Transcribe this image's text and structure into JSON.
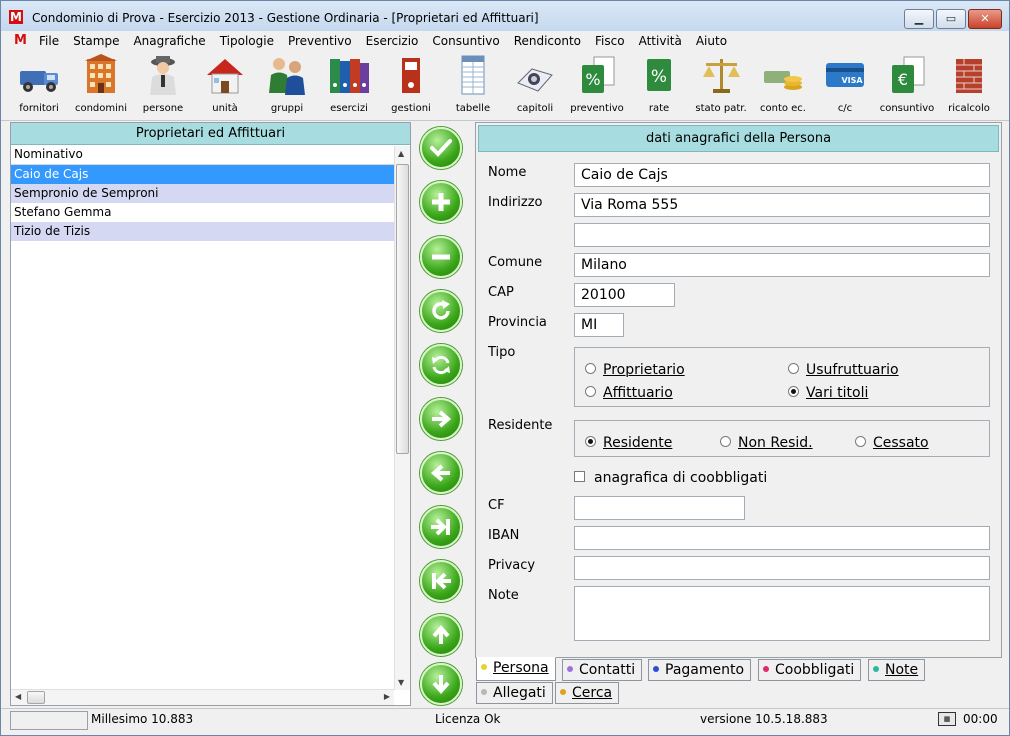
{
  "window": {
    "app_letter": "M",
    "title": "Condominio di Prova - Esercizio 2013 - Gestione Ordinaria - [Proprietari ed Affittuari]",
    "min_glyph": "▁",
    "max_glyph": "▭",
    "close_glyph": "✕"
  },
  "menu": {
    "icon_letter": "M",
    "items": [
      "File",
      "Stampe",
      "Anagrafiche",
      "Tipologie",
      "Preventivo",
      "Esercizio",
      "Consuntivo",
      "Rendiconto",
      "Fisco",
      "Attività",
      "Aiuto"
    ],
    "mdi_min": "_",
    "mdi_restore": "⧉",
    "mdi_close": "✕"
  },
  "toolbar": {
    "items": [
      {
        "label": "fornitori",
        "icon": "truck-icon"
      },
      {
        "label": "condomini",
        "icon": "building-icon"
      },
      {
        "label": "persone",
        "icon": "person-icon"
      },
      {
        "label": "unità",
        "icon": "house-icon"
      },
      {
        "label": "gruppi",
        "icon": "group-icon"
      },
      {
        "label": "esercizi",
        "icon": "binders-icon"
      },
      {
        "label": "gestioni",
        "icon": "binder-icon"
      },
      {
        "label": "tabelle",
        "icon": "table-icon"
      },
      {
        "label": "capitoli",
        "icon": "phonebook-icon"
      },
      {
        "label": "preventivo",
        "icon": "percent-doc-icon"
      },
      {
        "label": "rate",
        "icon": "percent-icon"
      },
      {
        "label": "stato patr.",
        "icon": "scale-icon"
      },
      {
        "label": "conto ec.",
        "icon": "coins-icon"
      },
      {
        "label": "c/c",
        "icon": "visa-card-icon"
      },
      {
        "label": "consuntivo",
        "icon": "euro-doc-icon"
      },
      {
        "label": "ricalcolo",
        "icon": "brickwall-icon"
      }
    ]
  },
  "list_panel": {
    "title": "Proprietari ed Affittuari",
    "column": "Nominativo",
    "rows": [
      "Caio de Cajs",
      "Sempronio de Semproni",
      "Stefano Gemma",
      "Tizio de Tizis"
    ],
    "selected_index": 0
  },
  "nav_buttons": [
    {
      "name": "confirm-button",
      "icon": "check-icon"
    },
    {
      "name": "add-button",
      "icon": "plus-icon"
    },
    {
      "name": "delete-button",
      "icon": "minus-icon"
    },
    {
      "name": "refresh-button",
      "icon": "refresh-icon"
    },
    {
      "name": "reload-button",
      "icon": "sync-icon"
    },
    {
      "name": "next-button",
      "icon": "arrow-right-icon"
    },
    {
      "name": "previous-button",
      "icon": "arrow-left-icon"
    },
    {
      "name": "last-button",
      "icon": "skip-end-icon"
    },
    {
      "name": "first-button",
      "icon": "skip-start-icon"
    },
    {
      "name": "move-up-button",
      "icon": "arrow-up-icon"
    },
    {
      "name": "move-down-button",
      "icon": "arrow-down-icon"
    }
  ],
  "form": {
    "title": "dati anagrafici della Persona",
    "labels": {
      "nome": "Nome",
      "indirizzo": "Indirizzo",
      "comune": "Comune",
      "cap": "CAP",
      "provincia": "Provincia",
      "tipo": "Tipo",
      "residente": "Residente",
      "cf": "CF",
      "iban": "IBAN",
      "privacy": "Privacy",
      "note": "Note"
    },
    "values": {
      "nome": "Caio de Cajs",
      "indirizzo": "Via Roma 555",
      "indirizzo2": "",
      "comune": "Milano",
      "cap": "20100",
      "provincia": "MI",
      "cf": "",
      "iban": "",
      "privacy": "",
      "note": ""
    },
    "tipo_options": [
      "Proprietario",
      "Usufruttuario",
      "Affittuario",
      "Vari titoli"
    ],
    "tipo_selected": "Vari titoli",
    "residente_options": [
      "Residente",
      "Non Resid.",
      "Cessato"
    ],
    "residente_selected": "Residente",
    "coobbligati_label": "anagrafica di coobbligati",
    "coobbligati_checked": false
  },
  "tabs": [
    {
      "label": "Persona",
      "color": "#e3d52a",
      "active": true
    },
    {
      "label": "Contatti",
      "color": "#a070e0",
      "active": false
    },
    {
      "label": "Pagamento",
      "color": "#2a4fd6",
      "active": false
    },
    {
      "label": "Coobbligati",
      "color": "#e02a6a",
      "active": false
    },
    {
      "label": "Note",
      "color": "#2ab8a0",
      "active": false
    },
    {
      "label": "Allegati",
      "color": "#b8b8b8",
      "active": false
    },
    {
      "label": "Cerca",
      "color": "#e0a020",
      "active": false
    }
  ],
  "status": {
    "millesimo": "Millesimo 10.883",
    "licenza": "Licenza Ok",
    "versione": "versione 10.5.18.883",
    "time": "00:00"
  },
  "colors": {
    "panel_header": "#a7dde0",
    "selection": "#3399ff",
    "alt_row": "#d5d8f2",
    "nav_green": "#3aa619"
  }
}
